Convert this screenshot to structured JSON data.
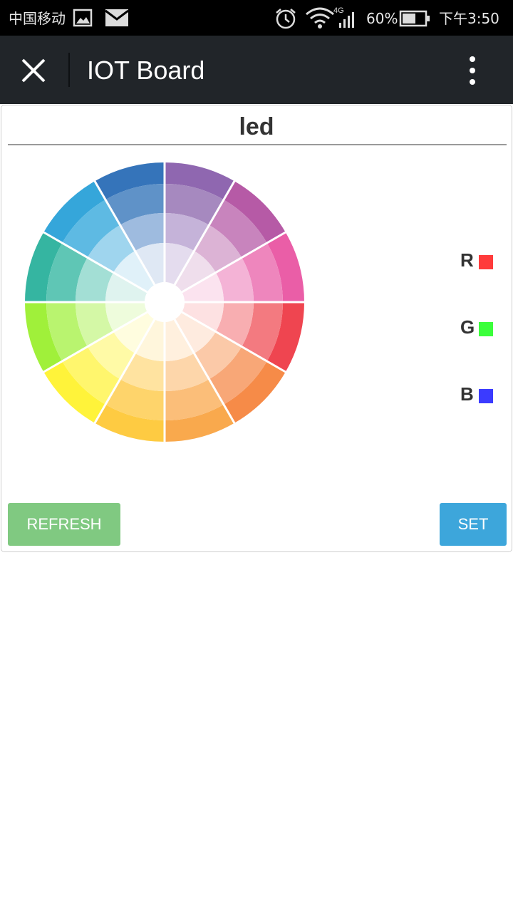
{
  "statusbar": {
    "carrier": "中国移动",
    "network_type": "4G",
    "battery_percent": "60%",
    "time": "下午3:50",
    "icons": [
      "image-icon",
      "mail-icon",
      "alarm-icon",
      "wifi-icon",
      "signal-icon",
      "battery-icon"
    ],
    "battery_level": 0.6
  },
  "toolbar": {
    "title": "IOT Board",
    "icons": [
      "close-icon",
      "more-vert-icon"
    ]
  },
  "card": {
    "title": "led",
    "wheel_segments": [
      {
        "name": "violet",
        "colors": [
          "#8f67b0",
          "#a689bf",
          "#c5b3d9",
          "#e4dcee"
        ]
      },
      {
        "name": "magenta",
        "colors": [
          "#b65aa6",
          "#c884bd",
          "#dcb3d5",
          "#efdeec"
        ]
      },
      {
        "name": "pink",
        "colors": [
          "#ea5ea7",
          "#ee86bd",
          "#f4b3d6",
          "#fbe3ef"
        ]
      },
      {
        "name": "red",
        "colors": [
          "#ef4550",
          "#f37a80",
          "#f8aeb1",
          "#fde1e2"
        ]
      },
      {
        "name": "orange",
        "colors": [
          "#f68b48",
          "#f8a777",
          "#fbc9a8",
          "#feebdf"
        ]
      },
      {
        "name": "light-orange",
        "colors": [
          "#f9a94d",
          "#fbbe79",
          "#fdd6aa",
          "#fff0de"
        ]
      },
      {
        "name": "amber",
        "colors": [
          "#fecb42",
          "#fed46b",
          "#ffe3a0",
          "#fff6dc"
        ]
      },
      {
        "name": "yellow",
        "colors": [
          "#fff33a",
          "#fff66d",
          "#fffaa6",
          "#fffddf"
        ]
      },
      {
        "name": "yellow-green",
        "colors": [
          "#a0f03a",
          "#b9f46f",
          "#d4f8a6",
          "#eefcdc"
        ]
      },
      {
        "name": "teal",
        "colors": [
          "#35b5a1",
          "#5fc6b5",
          "#a3dfd5",
          "#dff3ef"
        ]
      },
      {
        "name": "sky-blue",
        "colors": [
          "#35a6da",
          "#5ebae3",
          "#9fd5ee",
          "#e0f1f9"
        ]
      },
      {
        "name": "blue",
        "colors": [
          "#3574ba",
          "#5f92c8",
          "#9ebbdf",
          "#dfe8f4"
        ]
      }
    ],
    "channels": [
      {
        "label": "R",
        "color": "#ff3b3b"
      },
      {
        "label": "G",
        "color": "#3bff3b"
      },
      {
        "label": "B",
        "color": "#3b3bff"
      }
    ],
    "refresh_label": "REFRESH",
    "set_label": "SET"
  },
  "colors": {
    "toolbar_bg": "#212529",
    "refresh_bg": "#80c981",
    "set_bg": "#3da6db"
  }
}
